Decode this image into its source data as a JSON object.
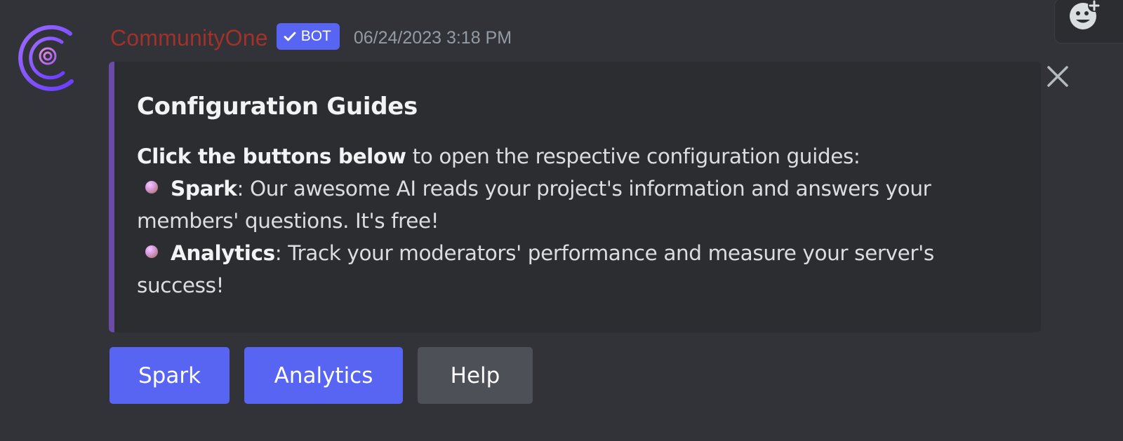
{
  "message": {
    "author": "CommunityOne",
    "bot_badge": "BOT",
    "timestamp": "06/24/2023 3:18 PM"
  },
  "embed": {
    "title": "Configuration Guides",
    "intro_bold": "Click the buttons below",
    "intro_rest": " to open the respective configuration guides:",
    "items": [
      {
        "name": "Spark",
        "description": ": Our awesome AI reads your project's information and answers your members' questions. It's free!"
      },
      {
        "name": "Analytics",
        "description": ": Track your moderators' performance and measure your server's success!"
      }
    ],
    "accent_color": "#6b4aa8"
  },
  "buttons": [
    {
      "label": "Spark",
      "style": "primary"
    },
    {
      "label": "Analytics",
      "style": "primary"
    },
    {
      "label": "Help",
      "style": "secondary"
    }
  ],
  "icons": {
    "avatar": "communityone-logo",
    "verified": "check-icon",
    "reaction": "add-reaction-icon",
    "dismiss": "close-icon"
  },
  "colors": {
    "background": "#313338",
    "username": "#a1312a",
    "blurple": "#5865f2",
    "secondary_button": "#4e5058"
  }
}
